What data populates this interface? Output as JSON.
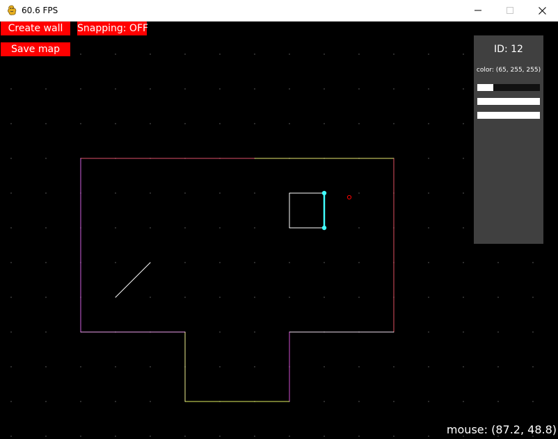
{
  "window": {
    "title": "60.6 FPS",
    "icon": "pygame-snake-icon",
    "controls": {
      "minimize_icon": "minimize-icon",
      "maximize_icon": "maximize-icon",
      "close_icon": "close-icon"
    }
  },
  "toolbar": {
    "create_wall_label": "Create wall",
    "snapping_label": "Snapping: OFF",
    "save_map_label": "Save map",
    "button_color": "#ff0000"
  },
  "inspector": {
    "id_text": "ID: 12",
    "color_text": "color: (65, 255, 255)",
    "sliders": [
      {
        "channel": "red",
        "value": 65,
        "max": 255
      },
      {
        "channel": "green",
        "value": 255,
        "max": 255
      },
      {
        "channel": "blue",
        "value": 255,
        "max": 255
      }
    ]
  },
  "status": {
    "mouse_text": "mouse: (87.2, 48.8)"
  },
  "colors": {
    "background": "#000000",
    "grid_dot": "#3a3a3a",
    "panel": "#404040",
    "selected_wall": "#41ffff",
    "cursor_marker": "#ff0000"
  }
}
